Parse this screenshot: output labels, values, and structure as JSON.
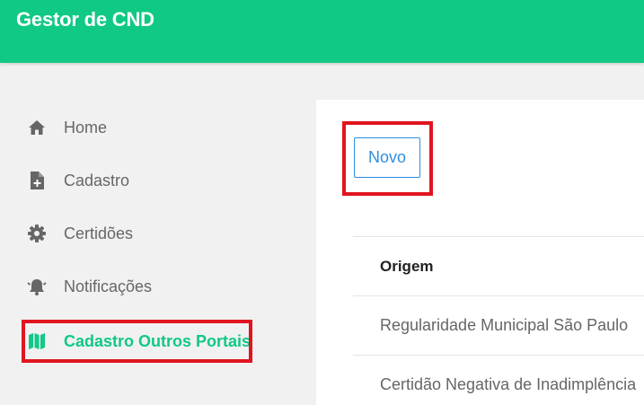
{
  "header": {
    "title": "Gestor de CND"
  },
  "colors": {
    "primary": "#10c985",
    "highlight": "#e0151f",
    "button": "#2f8ee0"
  },
  "sidebar": {
    "items": [
      {
        "label": "Home",
        "icon": "home-icon"
      },
      {
        "label": "Cadastro",
        "icon": "file-plus-icon"
      },
      {
        "label": "Certidões",
        "icon": "gear-icon"
      },
      {
        "label": "Notificações",
        "icon": "bell-icon"
      },
      {
        "label": "Cadastro Outros Portais",
        "icon": "map-icon",
        "active": true
      }
    ]
  },
  "main": {
    "new_button_label": "Novo",
    "table": {
      "columns": [
        "Origem"
      ],
      "rows": [
        "Regularidade Municipal São Paulo",
        "Certidão Negativa de Inadimplência"
      ]
    }
  }
}
